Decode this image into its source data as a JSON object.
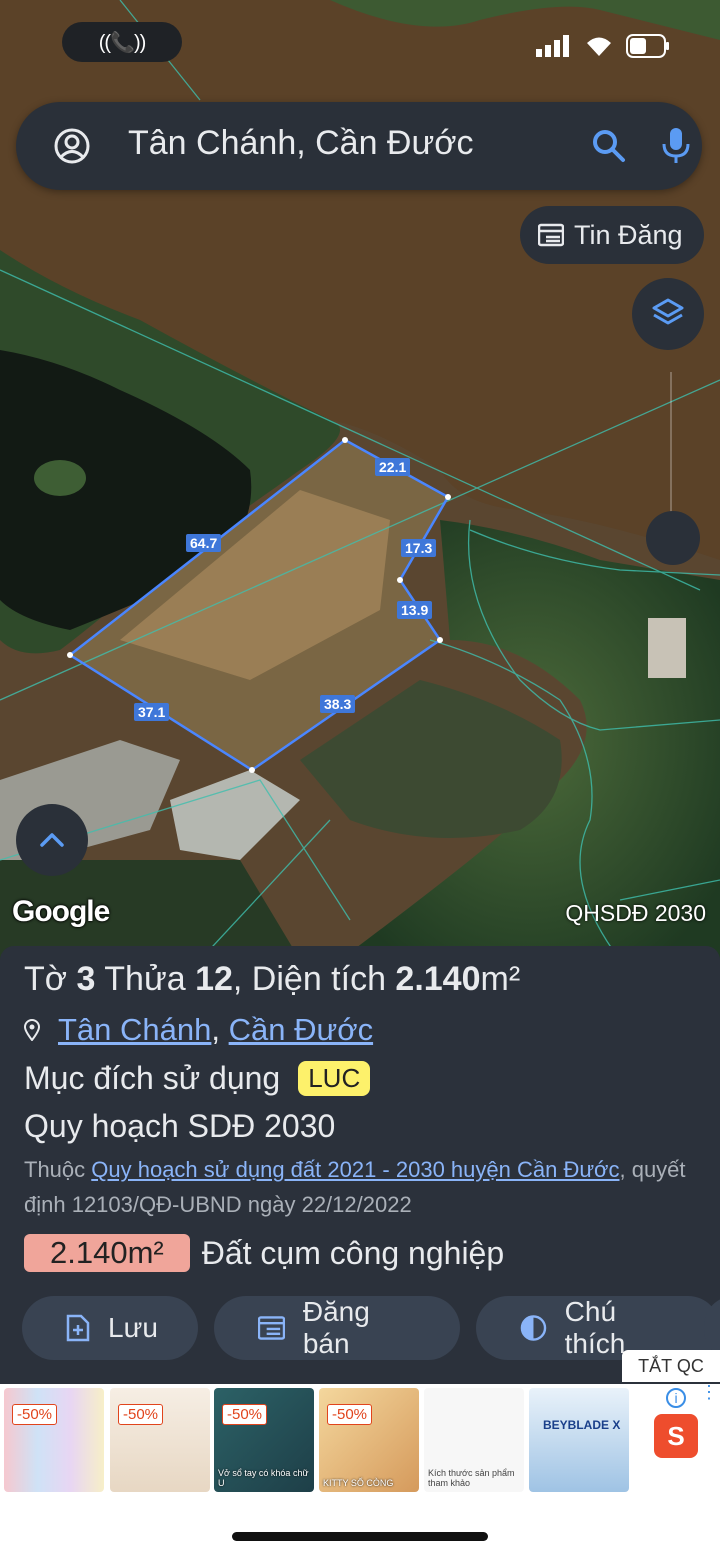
{
  "status_bar": {
    "call_indicator": "((📞))"
  },
  "search": {
    "query": "Tân Chánh, Cần Đước"
  },
  "map": {
    "tin_dang_label": "Tin Đăng",
    "google_logo": "Google",
    "layer_label": "QHSDĐ 2030",
    "edges": [
      "22.1",
      "17.3",
      "13.9",
      "38.3",
      "37.1",
      "64.7"
    ]
  },
  "panel": {
    "title_a": "Tờ ",
    "title_b": "3",
    "title_c": " Thửa ",
    "title_d": "12",
    "title_e": ", Diện tích ",
    "title_f": "2.140",
    "title_g": "m²",
    "loc_a": "Tân Chánh",
    "loc_sep": ", ",
    "loc_b": "Cần Đước",
    "purpose_label": "Mục đích sử dụng",
    "purpose_badge": "LUC",
    "plan_label": "Quy hoạch SDĐ 2030",
    "belongs_prefix": "Thuộc ",
    "belongs_link": "Quy hoạch sử dụng đất 2021 - 2030 huyện Cần Đước",
    "belongs_suffix": ", quyết định 12103/QĐ-UBND ngày 22/12/2022",
    "area_chip": "2.140m²",
    "area_text": "Đất cụm công nghiệp"
  },
  "actions": {
    "save": "Lưu",
    "post": "Đăng bán",
    "legend": "Chú thích"
  },
  "ad": {
    "close": "TẮT QC",
    "items": [
      {
        "discount": "-50%",
        "caption": ""
      },
      {
        "discount": "-50%",
        "caption": ""
      },
      {
        "discount": "-50%",
        "caption": "Vở sổ tay có khóa chữ U"
      },
      {
        "discount": "-50%",
        "caption": "KITTY SỔ CÒNG"
      },
      {
        "discount": "",
        "caption": "Kích thước sản phẩm tham khảo"
      },
      {
        "discount": "",
        "caption": "BEYBLADE X"
      }
    ],
    "shop_letter": "S"
  },
  "colors": {
    "panel_bg": "#2b313b",
    "accent_blue": "#8ab4f8",
    "parcel_line": "#4a86ff"
  }
}
